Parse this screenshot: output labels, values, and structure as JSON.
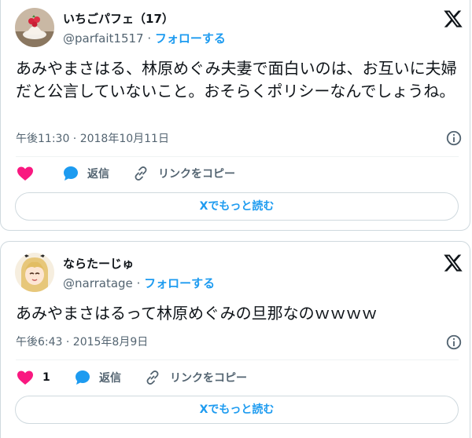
{
  "tweets": [
    {
      "name": "いちごパフェ（17）",
      "handle": "@parfait1517",
      "separator": "·",
      "follow": "フォローする",
      "text": "あみやまさはる、林原めぐみ夫妻で面白いのは、お互いに夫婦だと公言していないこと。おそらくポリシーなんでしょうね。",
      "time": "午後11:30 · 2018年10月11日",
      "likes": "",
      "reply": "返信",
      "copy_link": "リンクをコピー",
      "read_more": "Xでもっと読む"
    },
    {
      "name": "ならたーじゅ",
      "handle": "@narratage",
      "separator": "·",
      "follow": "フォローする",
      "text": "あみやまさはるって林原めぐみの旦那なのｗｗｗｗ",
      "time": "午後6:43 · 2015年8月9日",
      "likes": "1",
      "reply": "返信",
      "copy_link": "リンクをコピー",
      "read_more": "Xでもっと読む"
    }
  ],
  "colors": {
    "like": "#f91880",
    "link": "#1d9bf0",
    "muted": "#536471",
    "border": "#cfd9de"
  },
  "icons": [
    "x-logo-icon",
    "info-icon",
    "heart-icon",
    "reply-icon",
    "link-icon"
  ]
}
